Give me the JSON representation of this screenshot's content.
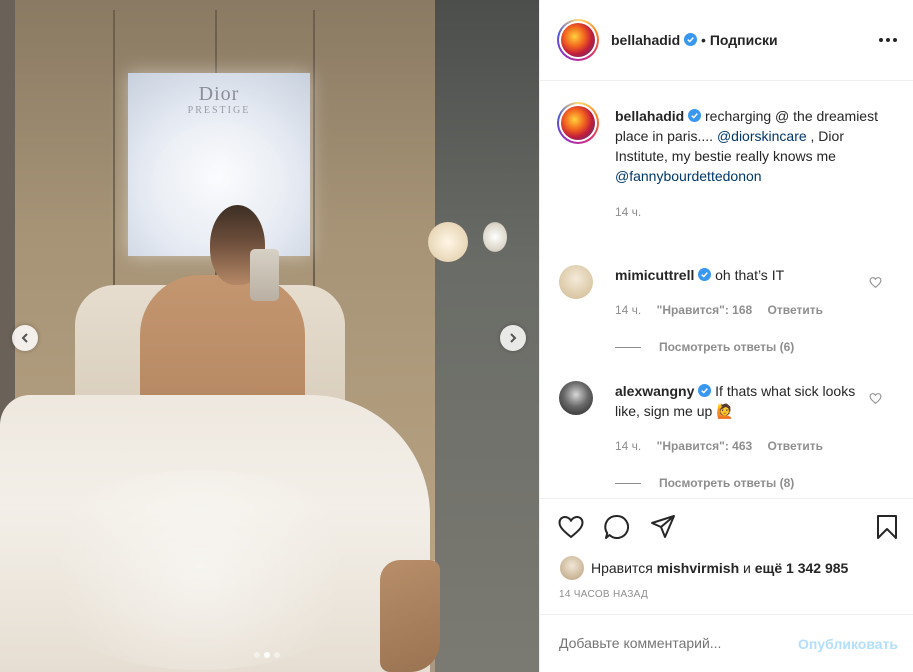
{
  "post": {
    "image_alt": "",
    "signage": {
      "brand": "Dior",
      "sub": "PRESTIGE"
    },
    "carousel": {
      "current_index": 2,
      "total": 3
    },
    "prev_icon": "chevron-left-icon",
    "next_icon": "chevron-right-icon"
  },
  "header": {
    "username": "bellahadid",
    "separator": "•",
    "follow_label": "Подписки",
    "more_icon": "more-dots-icon"
  },
  "caption": {
    "username": "bellahadid",
    "text_1": "recharging @ the dreamiest place in paris....",
    "mention_1": "@diorskincare",
    "text_2": ", Dior Institute, my bestie really knows me",
    "mention_2": "@fannybourdettedonon",
    "time": "14 ч."
  },
  "comments": [
    {
      "username": "mimicuttrell",
      "text": "oh that’s IT",
      "time": "14 ч.",
      "likes": "\"Нравится\": 168",
      "reply": "Ответить",
      "view_replies": "Посмотреть ответы (6)"
    },
    {
      "username": "alexwangny",
      "text": "If thats what sick looks like, sign me up 🙋",
      "time": "14 ч.",
      "likes": "\"Нравится\": 463",
      "reply": "Ответить",
      "view_replies": "Посмотреть ответы (8)"
    }
  ],
  "actions": {
    "like_icon": "heart-icon",
    "comment_icon": "comment-icon",
    "share_icon": "share-icon",
    "save_icon": "bookmark-icon"
  },
  "likes": {
    "prefix": "Нравится",
    "user": "mishvirmish",
    "middle": "и",
    "count": "ещё 1 342 985"
  },
  "timestamp": "14 ЧАСОВ НАЗАД",
  "comment_box": {
    "placeholder": "Добавьте комментарий...",
    "publish_label": "Опубликовать"
  },
  "colors": {
    "link": "#00376b",
    "verified": "#3897f0",
    "publish_disabled": "#b2dffc",
    "muted": "#8e8e8e"
  }
}
